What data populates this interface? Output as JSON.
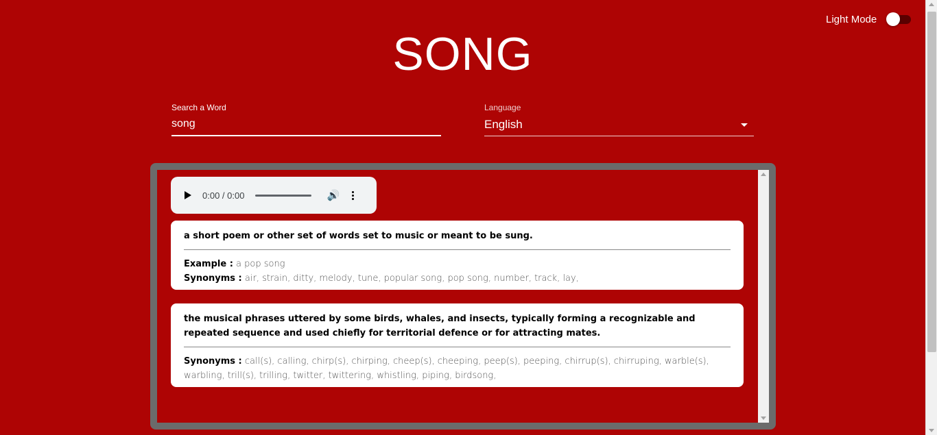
{
  "theme_toggle": {
    "label": "Light Mode",
    "state": "off"
  },
  "word_title": "SONG",
  "search": {
    "label": "Search a Word",
    "value": "song"
  },
  "language": {
    "label": "Language",
    "selected": "English"
  },
  "audio_player": {
    "time": "0:00 / 0:00"
  },
  "definitions": [
    {
      "definition": "a short poem or other set of words set to music or meant to be sung.",
      "example_label": "Example :",
      "example": "a pop song",
      "synonyms_label": "Synonyms :",
      "synonyms": "air, strain, ditty, melody, tune, popular song, pop song, number, track, lay,"
    },
    {
      "definition": "the musical phrases uttered by some birds, whales, and insects, typically forming a recognizable and repeated sequence and used chiefly for territorial defence or for attracting mates.",
      "synonyms_label": "Synonyms :",
      "synonyms": "call(s), calling, chirp(s), chirping, cheep(s), cheeping, peep(s), peeping, chirrup(s), chirruping, warble(s), warbling, trill(s), trilling, twitter, twittering, whistling, piping, birdsong,"
    }
  ],
  "colors": {
    "background": "#ae0404",
    "frame": "#6b6b6b",
    "card": "#ffffff"
  }
}
